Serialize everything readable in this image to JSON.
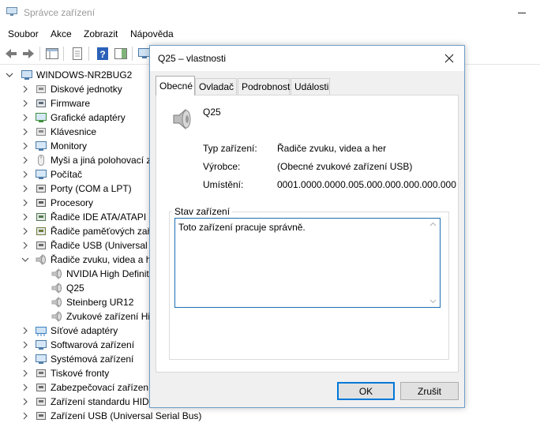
{
  "window": {
    "title": "Správce zařízení",
    "icon": "device-manager-icon"
  },
  "menu": [
    "Soubor",
    "Akce",
    "Zobrazit",
    "Nápověda"
  ],
  "toolbar": {
    "icons": [
      "back-arrow-icon",
      "forward-arrow-icon",
      "show-hide-tree-icon",
      "properties-icon",
      "help-icon",
      "action-pane-icon",
      "monitor-icon"
    ]
  },
  "tree": {
    "root": "WINDOWS-NR2BUG2",
    "items": [
      {
        "label": "Diskové jednotky",
        "icon": "disk-drive-icon",
        "level": 1,
        "expanded": false
      },
      {
        "label": "Firmware",
        "icon": "firmware-icon",
        "level": 1,
        "expanded": false
      },
      {
        "label": "Grafické adaptéry",
        "icon": "display-adapter-icon",
        "level": 1,
        "expanded": false
      },
      {
        "label": "Klávesnice",
        "icon": "keyboard-icon",
        "level": 1,
        "expanded": false
      },
      {
        "label": "Monitory",
        "icon": "monitor-icon",
        "level": 1,
        "expanded": false
      },
      {
        "label": "Myši a jiná polohovací z",
        "icon": "mouse-icon",
        "level": 1,
        "expanded": false
      },
      {
        "label": "Počítač",
        "icon": "computer-icon",
        "level": 1,
        "expanded": false
      },
      {
        "label": "Porty (COM a LPT)",
        "icon": "port-icon",
        "level": 1,
        "expanded": false
      },
      {
        "label": "Procesory",
        "icon": "processor-icon",
        "level": 1,
        "expanded": false
      },
      {
        "label": "Řadiče IDE ATA/ATAPI",
        "icon": "ide-controller-icon",
        "level": 1,
        "expanded": false
      },
      {
        "label": "Řadiče paměťových zaří",
        "icon": "storage-controller-icon",
        "level": 1,
        "expanded": false
      },
      {
        "label": "Řadiče USB (Universal Se",
        "icon": "usb-controller-icon",
        "level": 1,
        "expanded": false
      },
      {
        "label": "Řadiče zvuku, videa a he",
        "icon": "sound-icon",
        "level": 1,
        "expanded": true
      },
      {
        "label": "NVIDIA High Definit",
        "icon": "speaker-icon",
        "level": 2
      },
      {
        "label": "Q25",
        "icon": "speaker-icon",
        "level": 2
      },
      {
        "label": "Steinberg UR12",
        "icon": "speaker-icon",
        "level": 2
      },
      {
        "label": "Zvukové zařízení Hig",
        "icon": "speaker-icon",
        "level": 2
      },
      {
        "label": "Síťové adaptéry",
        "icon": "network-adapter-icon",
        "level": 1,
        "expanded": false
      },
      {
        "label": "Softwarová zařízení",
        "icon": "software-device-icon",
        "level": 1,
        "expanded": false
      },
      {
        "label": "Systémová zařízení",
        "icon": "system-device-icon",
        "level": 1,
        "expanded": false
      },
      {
        "label": "Tiskové fronty",
        "icon": "printer-icon",
        "level": 1,
        "expanded": false
      },
      {
        "label": "Zabezpečovací zařízení",
        "icon": "security-device-icon",
        "level": 1,
        "expanded": false
      },
      {
        "label": "Zařízení standardu HID",
        "icon": "hid-icon",
        "level": 1,
        "expanded": false
      },
      {
        "label": "Zařízení USB (Universal Serial Bus)",
        "icon": "usb-device-icon",
        "level": 1,
        "expanded": false
      }
    ]
  },
  "dialog": {
    "title": "Q25 – vlastnosti",
    "tabs": [
      "Obecné",
      "Ovladač",
      "Podrobnosti",
      "Události"
    ],
    "active_tab": "Obecné",
    "device_name": "Q25",
    "props": [
      {
        "label": "Typ zařízení:",
        "value": "Řadiče zvuku, videa a her"
      },
      {
        "label": "Výrobce:",
        "value": "(Obecné zvukové zařízení USB)"
      },
      {
        "label": "Umístění:",
        "value": "0001.0000.0000.005.000.000.000.000.000"
      }
    ],
    "status_legend": "Stav zařízení",
    "status_text": "Toto zařízení pracuje správně.",
    "ok_label": "OK",
    "cancel_label": "Zrušit"
  }
}
